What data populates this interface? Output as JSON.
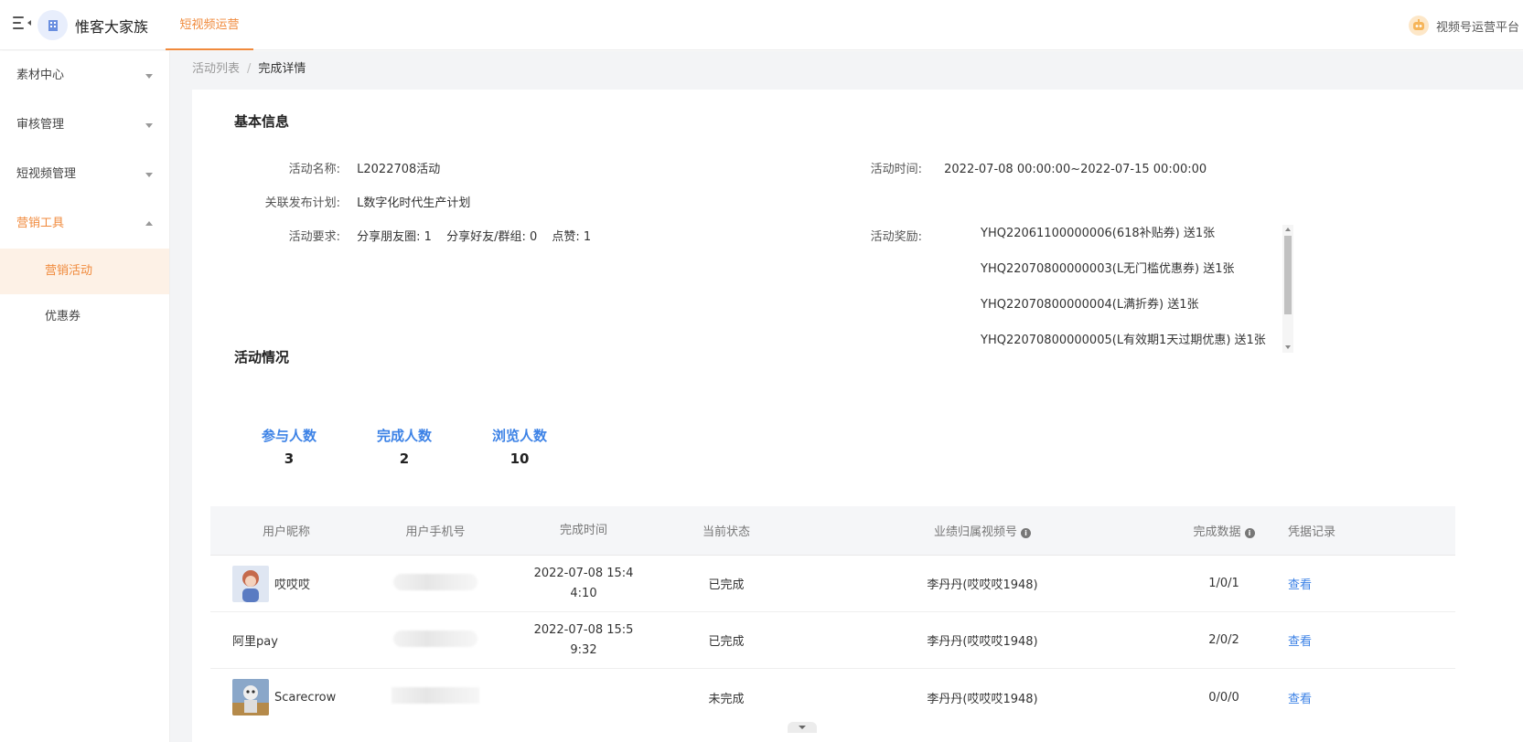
{
  "app": {
    "name": "惟客大家族",
    "top_tab": "短视频运营",
    "platform": "视频号运营平台"
  },
  "sidebar": {
    "items": [
      {
        "label": "素材中心"
      },
      {
        "label": "审核管理"
      },
      {
        "label": "短视频管理"
      },
      {
        "label": "营销工具"
      }
    ],
    "sub_items": [
      {
        "label": "营销活动"
      },
      {
        "label": "优惠券"
      }
    ]
  },
  "breadcrumb": {
    "parent": "活动列表",
    "separator": "/",
    "current": "完成详情"
  },
  "basic_info": {
    "title": "基本信息",
    "name_label": "活动名称:",
    "name_value": "L2022708活动",
    "time_label": "活动时间:",
    "time_value": "2022-07-08 00:00:00~2022-07-15 00:00:00",
    "plan_label": "关联发布计划:",
    "plan_value": "L数字化时代生产计划",
    "req_label": "活动要求:",
    "req_items": [
      "分享朋友圈: 1",
      "分享好友/群组: 0",
      "点赞: 1"
    ],
    "reward_label": "活动奖励:",
    "rewards": [
      "YHQ22061100000006(618补贴券) 送1张",
      "YHQ22070800000003(L无门槛优惠券) 送1张",
      "YHQ22070800000004(L满折券) 送1张",
      "YHQ22070800000005(L有效期1天过期优惠) 送1张"
    ]
  },
  "activity": {
    "title": "活动情况",
    "stats": [
      {
        "label": "参与人数",
        "value": "3"
      },
      {
        "label": "完成人数",
        "value": "2"
      },
      {
        "label": "浏览人数",
        "value": "10"
      }
    ]
  },
  "table": {
    "headers": {
      "nickname": "用户昵称",
      "phone": "用户手机号",
      "time": "完成时间",
      "status": "当前状态",
      "channel": "业绩归属视频号",
      "data": "完成数据",
      "record": "凭据记录"
    },
    "rows": [
      {
        "nickname": "哎哎哎",
        "time_line1": "2022-07-08 15:4",
        "time_line2": "4:10",
        "status": "已完成",
        "channel": "李丹丹(哎哎哎1948)",
        "data": "1/0/1",
        "action": "查看"
      },
      {
        "nickname": "阿里pay",
        "time_line1": "2022-07-08 15:5",
        "time_line2": "9:32",
        "status": "已完成",
        "channel": "李丹丹(哎哎哎1948)",
        "data": "2/0/2",
        "action": "查看"
      },
      {
        "nickname": "Scarecrow",
        "time_line1": "",
        "time_line2": "",
        "status": "未完成",
        "channel": "李丹丹(哎哎哎1948)",
        "data": "0/0/0",
        "action": "查看"
      }
    ]
  },
  "colors": {
    "accent": "#f08a3c",
    "link": "#3c82e6"
  }
}
